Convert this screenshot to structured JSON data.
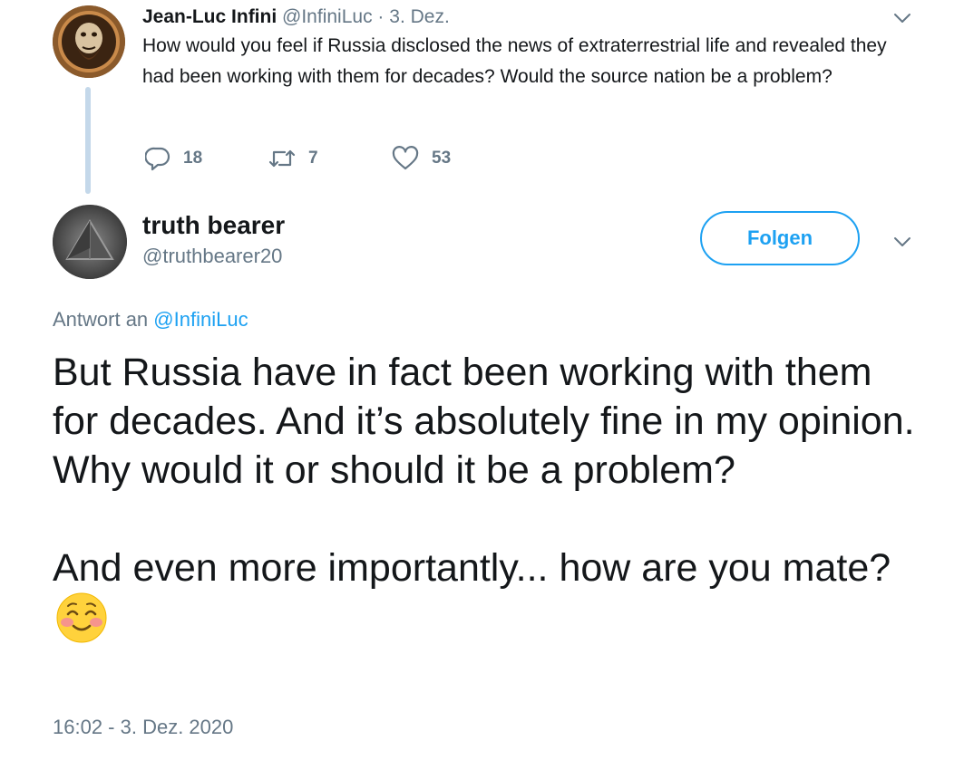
{
  "parent_tweet": {
    "author_name": "Jean-Luc Infini",
    "author_handle": "@InfiniLuc",
    "separator": "·",
    "date": "3. Dez.",
    "text": "How would you feel if Russia disclosed the news of extraterrestrial life and revealed they had been working with them for decades? Would the source nation be a problem?",
    "replies_count": "18",
    "retweets_count": "7",
    "likes_count": "53",
    "icons": [
      "reply-icon",
      "retweet-icon",
      "like-icon",
      "chevron-down-icon"
    ]
  },
  "reply_tweet": {
    "author_name": "truth bearer",
    "author_handle": "@truthbearer20",
    "follow_label": "Folgen",
    "reply_to_prefix": "Antwort an",
    "reply_to_handle": "@InfiniLuc",
    "text": "But Russia have in fact been working with them for decades. And it’s absolutely fine in my opinion. Why would it or should it be a problem?\n\nAnd even more importantly... how are you mate?",
    "emoji": "smiling-face-with-blush-emoji",
    "timestamp": "16:02 - 3. Dez. 2020"
  },
  "colors": {
    "text": "#14171a",
    "secondary": "#657786",
    "accent": "#1da1f2",
    "thread_line": "#c4d8ea"
  }
}
